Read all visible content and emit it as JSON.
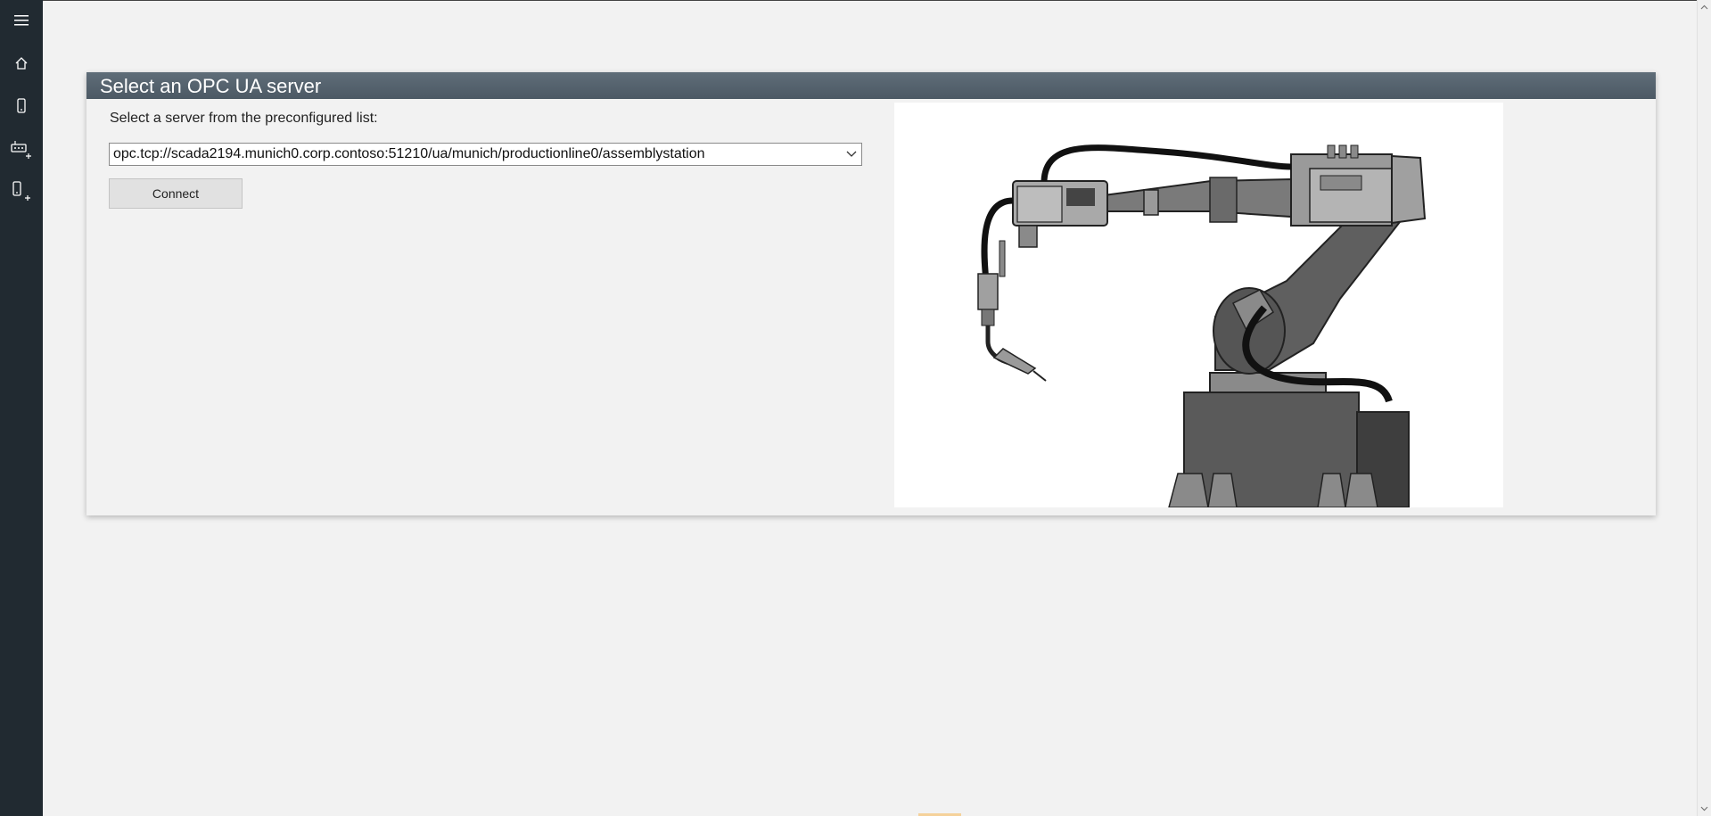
{
  "sidebar": {
    "items": [
      {
        "icon": "hamburger-menu-icon"
      },
      {
        "icon": "home-icon"
      },
      {
        "icon": "device-icon"
      },
      {
        "icon": "add-gateway-icon"
      },
      {
        "icon": "add-device-icon"
      }
    ]
  },
  "panel": {
    "title": "Select an OPC UA server",
    "instruction": "Select a server from the preconfigured list:",
    "selected_server": "opc.tcp://scada2194.munich0.corp.contoso:51210/ua/munich/productionline0/assemblystation",
    "connect_label": "Connect"
  },
  "colors": {
    "sidebar": "#212a31",
    "header": "#56636e",
    "background": "#f2f2f2"
  }
}
